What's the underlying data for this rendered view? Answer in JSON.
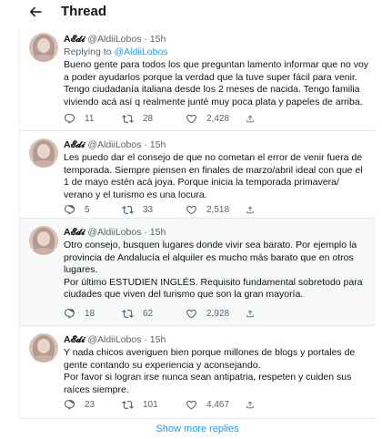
{
  "header": {
    "title": "Thread"
  },
  "tweets": [
    {
      "display_name": "A𝓔𝓭𝓲",
      "handle": "@AldiiLobos",
      "dot": "·",
      "time": "15h",
      "replying_prefix": "Replying to ",
      "replying_handle": "@AldiiLobos",
      "text": "Bueno gente para todos los que preguntan lamento informar que no voy a poder ayudarlos porque la verdad que la tuve super fácil para venir.\nTengo ciudadanía italiana desde los 2 meses de nacida. Tengo familia viviendo acá así q realmente junté muy poca plata y papeles de arriba.",
      "replies": "11",
      "retweets": "28",
      "likes": "2,428"
    },
    {
      "display_name": "A𝓔𝓭𝓲",
      "handle": "@AldiiLobos",
      "dot": "·",
      "time": "15h",
      "text": "Les puedo dar el consejo de que no cometan el error de venir fuera de temporada. Siempre piensen en finales de marzo/abril ideal con que el 1 de mayo estén acá joya. Porque inicia la temporada primavera/ verano y el turismo es una locura.",
      "replies": "5",
      "retweets": "33",
      "likes": "2,518"
    },
    {
      "display_name": "A𝓔𝓭𝓲",
      "handle": "@AldiiLobos",
      "dot": "·",
      "time": "15h",
      "text": "Otro consejo, busquen lugares donde vivir sea barato. Por ejemplo la provincia de Andalucía el alquiler es mucho más barato que en otros lugares.\nPor último ESTUDIEN INGLÉS. Requisito fundamental sobretodo para ciudades que viven del turismo que son la gran mayoría.",
      "replies": "18",
      "retweets": "62",
      "likes": "2,928"
    },
    {
      "display_name": "A𝓔𝓭𝓲",
      "handle": "@AldiiLobos",
      "dot": "·",
      "time": "15h",
      "text": "Y nada chicos averiguen bien porque millones de blogs y portales de gente contando su experiencia y aconsejando.\nPor favor si logran irse nunca sean antipatria, respeten y cuiden sus raíces siempre.",
      "replies": "23",
      "retweets": "101",
      "likes": "4,467"
    }
  ],
  "show_more": "Show more replies",
  "colors": {
    "accent": "#1d9bf0",
    "muted": "#536471",
    "text": "#0f1419",
    "highlight_bg": "#f7f9f9"
  },
  "icons": [
    "back-arrow-icon",
    "reply-icon",
    "retweet-icon",
    "like-icon",
    "share-icon"
  ]
}
